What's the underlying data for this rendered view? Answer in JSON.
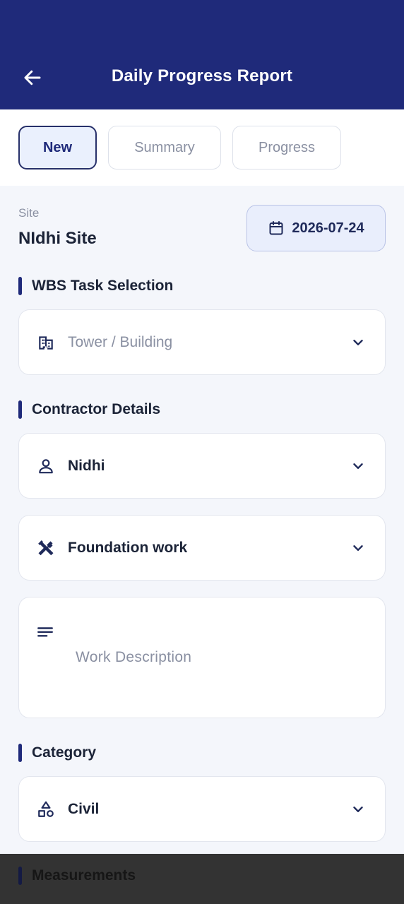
{
  "header": {
    "title": "Daily Progress Report",
    "back_icon": "arrow-left-icon",
    "background": "#1f2a7a"
  },
  "tabs": [
    {
      "label": "New",
      "active": true
    },
    {
      "label": "Summary",
      "active": false
    },
    {
      "label": "Progress",
      "active": false
    }
  ],
  "site": {
    "label": "Site",
    "name": "NIdhi Site"
  },
  "date": {
    "value": "2026-07-24",
    "icon": "calendar-icon"
  },
  "wbs": {
    "title": "WBS Task Selection",
    "tower": {
      "placeholder": "Tower / Building",
      "icon": "building-icon"
    }
  },
  "contractor": {
    "title": "Contractor Details",
    "name": {
      "value": "Nidhi",
      "icon": "person-icon"
    },
    "work": {
      "value": "Foundation work",
      "icon": "tools-icon"
    },
    "description": {
      "placeholder": "Work Description",
      "icon": "notes-icon"
    }
  },
  "category": {
    "title": "Category",
    "value": "Civil",
    "icon": "category-icon"
  },
  "measurements": {
    "title": "Measurements"
  },
  "colors": {
    "accent": "#1f2a7a",
    "tab_active_bg": "#eaf0fd",
    "page_bg": "#f4f6fb",
    "muted_text": "#8a90a2"
  }
}
